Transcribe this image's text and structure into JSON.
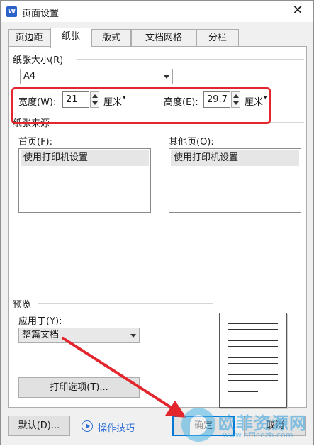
{
  "window": {
    "title": "页面设置",
    "app_icon_letter": "W"
  },
  "tabs": [
    {
      "label": "页边距"
    },
    {
      "label": "纸张",
      "active": true
    },
    {
      "label": "版式"
    },
    {
      "label": "文档网格"
    },
    {
      "label": "分栏"
    }
  ],
  "paper_size": {
    "group_label": "纸张大小(R)",
    "selected": "A4",
    "width_label": "宽度(W):",
    "width_value": "21",
    "width_unit": "厘米",
    "height_label": "高度(E):",
    "height_value": "29.7",
    "height_unit": "厘米"
  },
  "paper_source": {
    "group_label": "纸张来源",
    "first_page_label": "首页(F):",
    "first_page_item": "使用打印机设置",
    "other_pages_label": "其他页(O):",
    "other_pages_item": "使用打印机设置"
  },
  "preview": {
    "group_label": "预览",
    "apply_to_label": "应用于(Y):",
    "apply_to_selected": "整篇文档",
    "print_options_label": "打印选项(T)..."
  },
  "footer": {
    "default_label": "默认(D)...",
    "tips_label": "操作技巧",
    "ok_label": "确定",
    "cancel_label": "取消"
  },
  "colors": {
    "highlight": "#e3262e",
    "accent": "#0078d7",
    "link": "#2f6fd6"
  },
  "watermark": {
    "brand": "欧菲资源网",
    "url": "www.officezb.com"
  }
}
